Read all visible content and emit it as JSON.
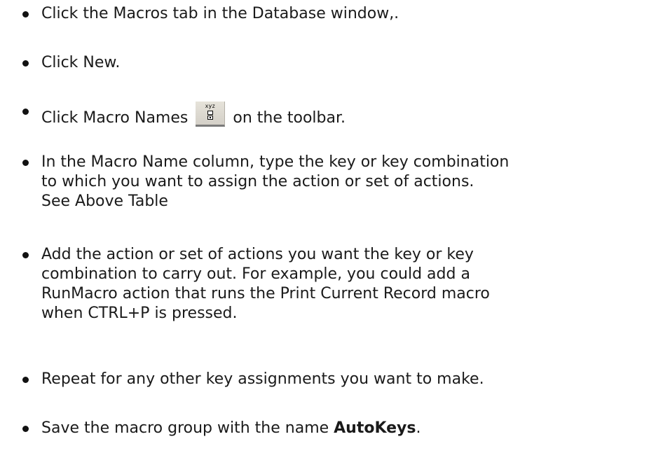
{
  "steps": [
    {
      "lines": [
        "Click the Macros tab in the Database window,."
      ]
    },
    {
      "lines": [
        "Click New."
      ]
    },
    {
      "before_icon": "Click Macro Names",
      "icon": "macro-names-icon",
      "icon_text": "xyz",
      "after_icon": "on the toolbar."
    },
    {
      "lines": [
        "In the Macro Name column, type the key or key combination",
        "to which you want to assign the action or set of actions.",
        "See Above Table"
      ]
    },
    {
      "lines": [
        "Add the action or set of actions you want the key or key",
        "combination to carry out. For example, you could add a",
        "RunMacro action that runs the Print Current Record macro",
        "when CTRL+P is pressed."
      ]
    },
    {
      "lines": [
        "Repeat for any other key assignments you want to make."
      ]
    },
    {
      "before_bold": "Save the macro group with the name ",
      "bold": "AutoKeys",
      "after_bold": "."
    }
  ]
}
